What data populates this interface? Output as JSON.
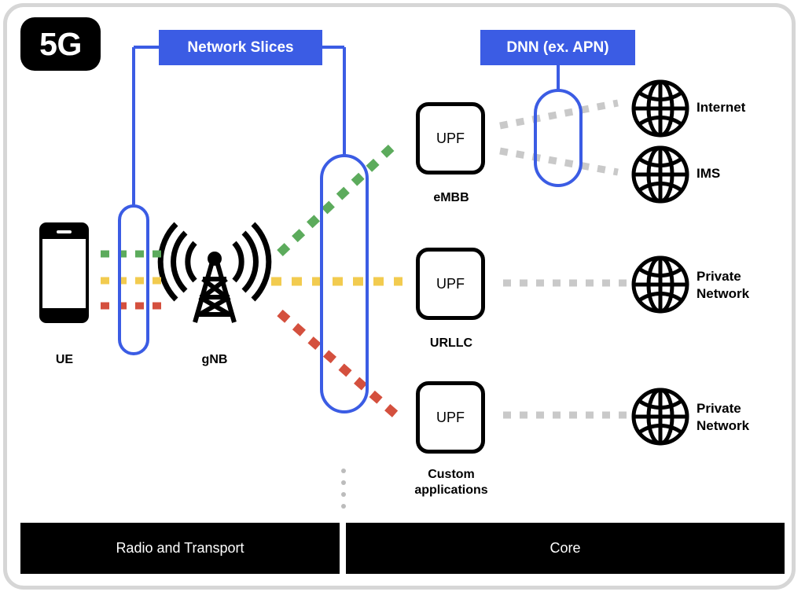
{
  "badge": {
    "label": "5G"
  },
  "headers": {
    "network_slices": "Network Slices",
    "dnn": "DNN (ex. APN)"
  },
  "nodes": {
    "ue": "UE",
    "gnb": "gNB"
  },
  "upfs": [
    {
      "title": "UPF",
      "label": "eMBB"
    },
    {
      "title": "UPF",
      "label": "URLLC"
    },
    {
      "title": "UPF",
      "label": "Custom\napplications"
    }
  ],
  "upf_labels": {
    "embb_title": "UPF",
    "embb_caption": "eMBB",
    "urllc_title": "UPF",
    "urllc_caption": "URLLC",
    "custom_title": "UPF",
    "custom_caption_line1": "Custom",
    "custom_caption_line2": "applications"
  },
  "networks": [
    {
      "label": "Internet"
    },
    {
      "label": "IMS"
    },
    {
      "label_line1": "Private",
      "label_line2": "Network"
    },
    {
      "label_line1": "Private",
      "label_line2": "Network"
    }
  ],
  "network_labels": {
    "internet": "Internet",
    "ims": "IMS",
    "private1_line1": "Private",
    "private1_line2": "Network",
    "private2_line1": "Private",
    "private2_line2": "Network"
  },
  "bottom_bars": {
    "radio": "Radio and Transport",
    "core": "Core"
  },
  "colors": {
    "blue": "#3b5ce4",
    "green": "#5cab5c",
    "yellow": "#f2cb4f",
    "red": "#d4503e",
    "gray_dotted": "#c9c9c9",
    "black": "#000000",
    "frame": "#d6d6d6"
  },
  "slice_flows": [
    {
      "name": "embb",
      "color": "#5cab5c",
      "style": "dotted"
    },
    {
      "name": "urllc",
      "color": "#f2cb4f",
      "style": "dotted"
    },
    {
      "name": "custom",
      "color": "#d4503e",
      "style": "dotted"
    }
  ]
}
